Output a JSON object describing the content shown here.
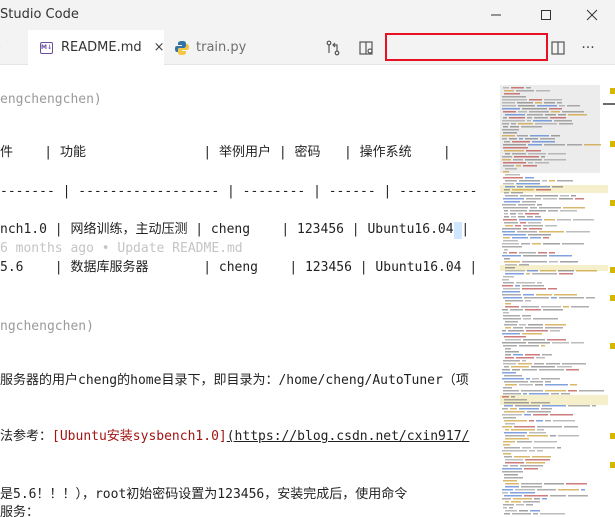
{
  "window": {
    "title": "Studio Code"
  },
  "tabs": [
    {
      "label": "README.md",
      "icon": "markdown-icon",
      "active": true,
      "close": "×"
    },
    {
      "label": "train.py",
      "icon": "python-icon",
      "active": false
    }
  ],
  "toolbar": {
    "more": "···"
  },
  "editor": {
    "lines": [
      "engchengchen)",
      "件    | 功能               | 举例用户 | 密码   | 操作系统    |",
      "------- | ------------------ | -------- | ------ | ----------",
      "nch1.0 | 网络训练，主动压测 | cheng    | 123456 | Ubuntu16.04 |",
      "6 months ago • Update README.md",
      "5.6    | 数据库服务器       | cheng    | 123456 | Ubuntu16.04 |",
      "ngchengchen)",
      "服务器的用户cheng的home目录下，即目录为：/home/cheng/AutoTuner（项",
      "法参考：",
      "[Ubuntu安装sysbench1.0]",
      "(https://blog.csdn.net/cxin917/",
      "是5.6！！！），root初始密码设置为123456，安装完成后，使用命令",
      "服务："
    ]
  },
  "colors": {
    "accent_red": "#e81123",
    "link_red": "#a31515",
    "scroll_marker": "#d7b600"
  }
}
